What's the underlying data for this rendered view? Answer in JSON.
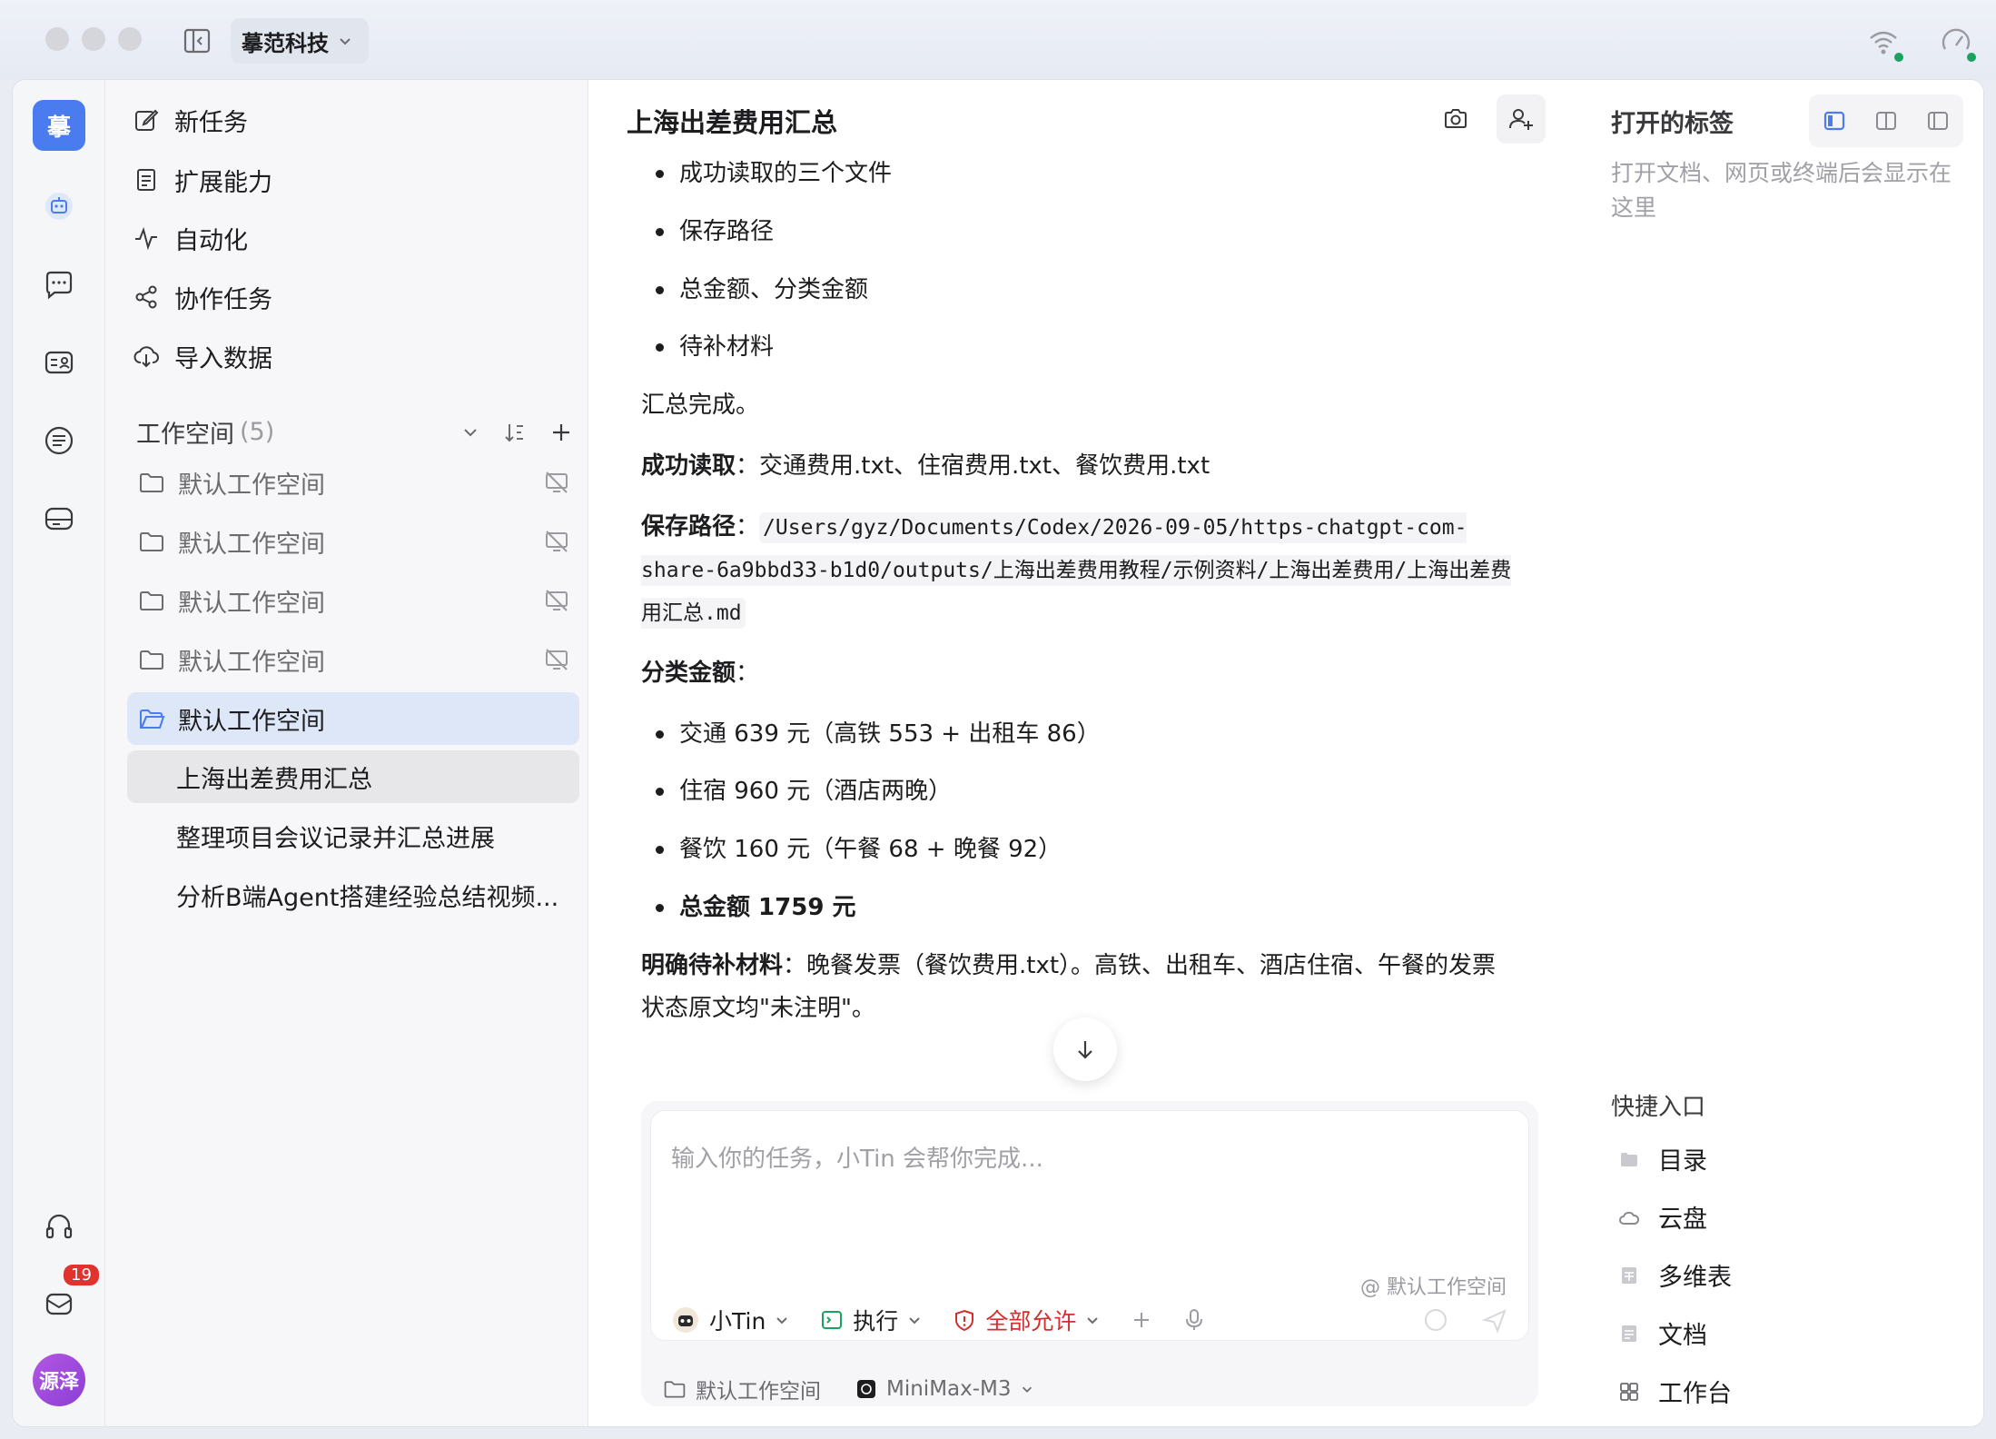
{
  "app": {
    "org_name": "摹范科技",
    "logo_char": "摹",
    "avatar_text": "源泽",
    "mail_badge": "19"
  },
  "nav": {
    "items": [
      {
        "label": "新任务",
        "icon": "edit-icon"
      },
      {
        "label": "扩展能力",
        "icon": "document-icon"
      },
      {
        "label": "自动化",
        "icon": "pulse-icon"
      },
      {
        "label": "协作任务",
        "icon": "share-icon"
      },
      {
        "label": "导入数据",
        "icon": "cloud-download-icon"
      }
    ],
    "workspace_title": "工作空间",
    "workspace_count": "(5)",
    "workspaces": [
      "默认工作空间",
      "默认工作空间",
      "默认工作空间",
      "默认工作空间",
      "默认工作空间"
    ],
    "tasks": [
      "上海出差费用汇总",
      "整理项目会议记录并汇总进展",
      "分析B端Agent搭建经验总结视频..."
    ]
  },
  "main": {
    "title": "上海出差费用汇总",
    "bullets_top": [
      "成功读取的三个文件",
      "保存路径",
      "总金额、分类金额",
      "待补材料"
    ],
    "summary_done": "汇总完成。",
    "read_label": "成功读取",
    "read_value": "：交通费用.txt、住宿费用.txt、餐饮费用.txt",
    "path_label": "保存路径",
    "path_colon": "：",
    "path_value": "/Users/gyz/Documents/Codex/2026-09-05/https-chatgpt-com-share-6a9bbd33-b1d0/outputs/上海出差费用教程/示例资料/上海出差费用/上海出差费用汇总.md",
    "category_label": "分类金额",
    "category_colon": "：",
    "categories": [
      "交通 639 元（高铁 553 + 出租车 86）",
      "住宿 960 元（酒店两晚）",
      "餐饮 160 元（午餐 68 + 晚餐 92）"
    ],
    "total": "总金额 1759 元",
    "pending_label": "明确待补材料",
    "pending_value": "：晚餐发票（餐饮费用.txt）。高铁、出租车、酒店住宿、午餐的发票状态原文均\"未注明\"。"
  },
  "composer": {
    "placeholder": "输入你的任务，小Tin 会帮你完成...",
    "workspace_tag": "@ 默认工作空间",
    "agent": "小Tin",
    "mode": "执行",
    "permission": "全部允许",
    "footer_workspace": "默认工作空间",
    "model": "MiniMax-M3"
  },
  "right_panel": {
    "title": "打开的标签",
    "empty_text": "打开文档、网页或终端后会显示在这里",
    "quick_title": "快捷入口",
    "quick_items": [
      {
        "label": "目录",
        "icon": "folder-icon"
      },
      {
        "label": "云盘",
        "icon": "cloud-icon"
      },
      {
        "label": "多维表",
        "icon": "table-icon"
      },
      {
        "label": "文档",
        "icon": "doc-icon"
      },
      {
        "label": "工作台",
        "icon": "grid-icon"
      }
    ]
  },
  "colors": {
    "accent": "#4a7cf0",
    "danger": "#d42f2f",
    "active_bg": "#dde7f8"
  }
}
